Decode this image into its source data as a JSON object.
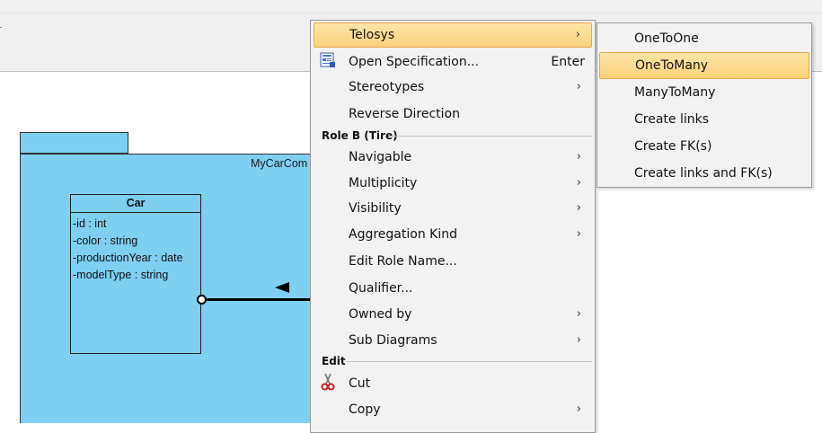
{
  "diagram": {
    "package_name": "MyCarCom",
    "class": {
      "name": "Car",
      "attributes": [
        "-id : int",
        "-color : string",
        "-productionYear : date",
        "-modelType : string"
      ]
    }
  },
  "context_menu": {
    "items": [
      {
        "label": "Telosys",
        "submenu": true,
        "highlighted": true
      },
      {
        "label": "Open Specification...",
        "shortcut": "Enter",
        "icon": "specification-icon"
      },
      {
        "label": "Stereotypes",
        "submenu": true
      },
      {
        "label": "Reverse Direction"
      }
    ],
    "section_role": "Role B (Tire)",
    "role_items": [
      {
        "label": "Navigable",
        "submenu": true
      },
      {
        "label": "Multiplicity",
        "submenu": true
      },
      {
        "label": "Visibility",
        "submenu": true
      },
      {
        "label": "Aggregation Kind",
        "submenu": true
      },
      {
        "label": "Edit Role Name..."
      },
      {
        "label": "Qualifier..."
      },
      {
        "label": "Owned by",
        "submenu": true
      },
      {
        "label": "Sub Diagrams",
        "submenu": true
      }
    ],
    "section_edit": "Edit",
    "edit_items": [
      {
        "label": "Cut",
        "icon": "scissors-icon"
      },
      {
        "label": "Copy",
        "submenu": true
      }
    ]
  },
  "telosys_submenu": {
    "items": [
      {
        "label": "OneToOne"
      },
      {
        "label": "OneToMany",
        "highlighted": true
      },
      {
        "label": "ManyToMany"
      },
      {
        "label": "Create links"
      },
      {
        "label": "Create FK(s)"
      },
      {
        "label": "Create links and FK(s)"
      }
    ]
  },
  "colors": {
    "package_fill": "#7ecff2",
    "highlight": "#fbd27c",
    "menu_bg": "#f2f2f2"
  }
}
